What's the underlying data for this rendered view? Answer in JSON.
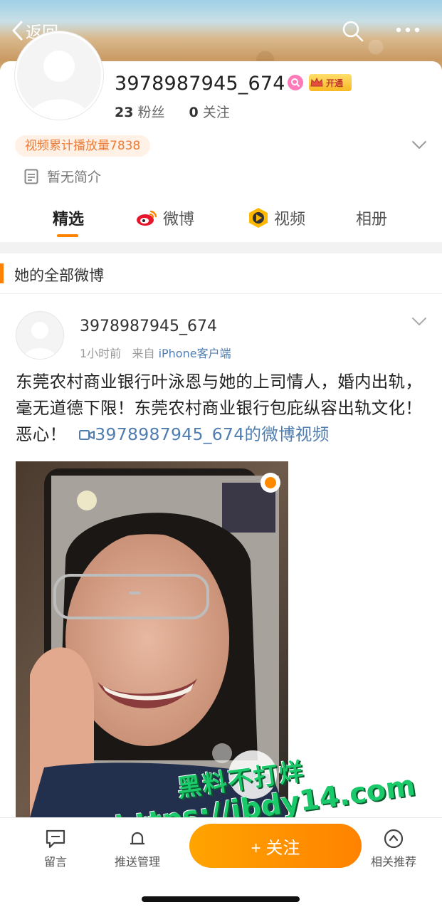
{
  "top_bar": {
    "back_label": "返回",
    "search_icon": "search-icon",
    "more_icon": "more-icon"
  },
  "profile": {
    "username": "3978987945_674",
    "vip_label": "开通",
    "fans_count": "23",
    "fans_label": "粉丝",
    "following_count": "0",
    "following_label": "关注",
    "views_label": "视频累计播放量7838",
    "intro": "暂无简介"
  },
  "tabs": [
    {
      "label": "精选",
      "active": true
    },
    {
      "label": "微博",
      "icon": "weibo-icon"
    },
    {
      "label": "视频",
      "icon": "video-icon"
    },
    {
      "label": "相册"
    }
  ],
  "section": {
    "title": "她的全部微博"
  },
  "post": {
    "username": "3978987945_674",
    "time": "1小时前",
    "from_label": "来自",
    "source": "iPhone客户端",
    "text": "东莞农村商业银行叶泳恩与她的上司情人，婚内出轨，毫无道德下限！东莞农村商业银行包庇纵容出轨文化！恶心！",
    "video_link": "3978987945_674的微博视频"
  },
  "watermark": {
    "line1": "黑料不打烊",
    "line2": "https://ibdy14.com"
  },
  "bottom_bar": {
    "comment_label": "留言",
    "push_label": "推送管理",
    "follow_label": "+ 关注",
    "related_label": "相关推荐"
  },
  "colors": {
    "accent": "#ff8200",
    "link": "#507daf",
    "pill_bg": "#fff1e6",
    "pill_text": "#ee7a36"
  }
}
